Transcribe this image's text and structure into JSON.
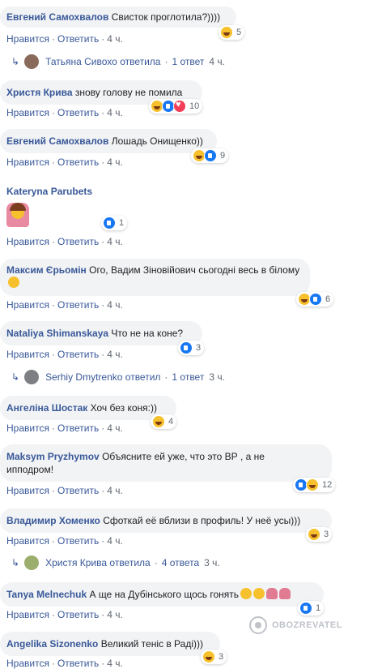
{
  "labels": {
    "like": "Нравится",
    "reply": "Ответить"
  },
  "colors": {
    "author": "#385898",
    "bubble": "#f2f3f5",
    "muted": "#606770",
    "like": "#1877f2",
    "haha": "#f7c02d",
    "love": "#f33e58"
  },
  "comments": [
    {
      "author": "Евгений Самохвалов",
      "text": "Свисток проглотила?))))",
      "time": "4 ч.",
      "reactions": [
        "haha"
      ],
      "count": "5"
    },
    {
      "author": "Христя Крива",
      "text": "знову голову не помила",
      "time": "4 ч.",
      "reactions": [
        "haha",
        "like",
        "love"
      ],
      "count": "10"
    },
    {
      "author": "Евгений Самохвалов",
      "text": "Лошадь Онищенко))",
      "time": "4 ч.",
      "reactions": [
        "haha",
        "like"
      ],
      "count": "9"
    },
    {
      "author": "Kateryna Parubets",
      "text": "",
      "time": "4 ч.",
      "reactions": [
        "like"
      ],
      "count": "1"
    },
    {
      "author": "Максим Єрьомін",
      "text": "Ого, Вадим Зіновійович сьогодні весь в білому",
      "time": "4 ч.",
      "reactions": [
        "haha",
        "like"
      ],
      "count": "6"
    },
    {
      "author": "Nataliya Shimanskaya",
      "text": "Что не на коне?",
      "time": "4 ч.",
      "reactions": [
        "like"
      ],
      "count": "3"
    },
    {
      "author": "Ангеліна Шостак",
      "text": "Хоч без коня:))",
      "time": "4 ч.",
      "reactions": [
        "haha"
      ],
      "count": "4"
    },
    {
      "author": "Maksym Pryzhymov",
      "text": "Объясните ей уже, что это ВР , а не",
      "text2": "ипподром!",
      "time": "4 ч.",
      "reactions": [
        "like",
        "haha"
      ],
      "count": "12"
    },
    {
      "author": "Владимир Хоменко",
      "text": "Сфоткай её вблизи в профиль! У неё усы)))",
      "time": "4 ч.",
      "reactions": [
        "haha"
      ],
      "count": "3"
    },
    {
      "author": "Tanya Melnechuk",
      "text": "А ще на Дубінського щось гонять",
      "time": "4 ч.",
      "reactions": [
        "like"
      ],
      "count": "1"
    },
    {
      "author": "Angelika Sizonenko",
      "text": "Великий теніс в Раді)))",
      "time": "4 ч.",
      "reactions": [
        "haha"
      ],
      "count": "3"
    }
  ],
  "replies": [
    {
      "name": "Татьяна Сивохо",
      "verb": "ответила",
      "count": "1 ответ",
      "time": "4 ч."
    },
    {
      "name": "Serhiy Dmytrenko",
      "verb": "ответил",
      "count": "1 ответ",
      "time": "3 ч."
    },
    {
      "name": "Христя Крива",
      "verb": "ответила",
      "count": "4 ответа",
      "time": "3 ч."
    }
  ],
  "watermark": "OBOZREVATEL"
}
